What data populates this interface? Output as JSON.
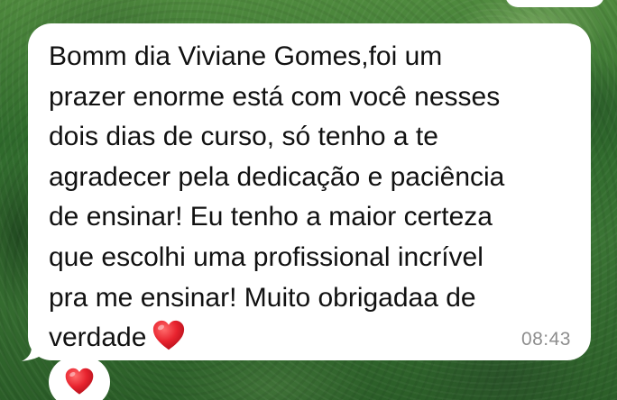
{
  "message": {
    "lines": [
      "Bomm dia Viviane Gomes,foi um",
      "prazer enorme está com você nesses",
      "dois dias de curso, só tenho a te",
      "agradecer pela dedicação e paciência",
      "de ensinar! Eu tenho a maior certeza",
      "que escolhi uma profissional incrível",
      "pra me ensinar! Muito obrigadaa de",
      "verdade"
    ],
    "inline_emoji": "red-heart",
    "time": "08:43"
  },
  "reaction": {
    "emoji": "red-heart"
  },
  "colors": {
    "bubble": "#ffffff",
    "text": "#111111",
    "timestamp": "#8e8e8e",
    "heart": "#e8232e"
  }
}
